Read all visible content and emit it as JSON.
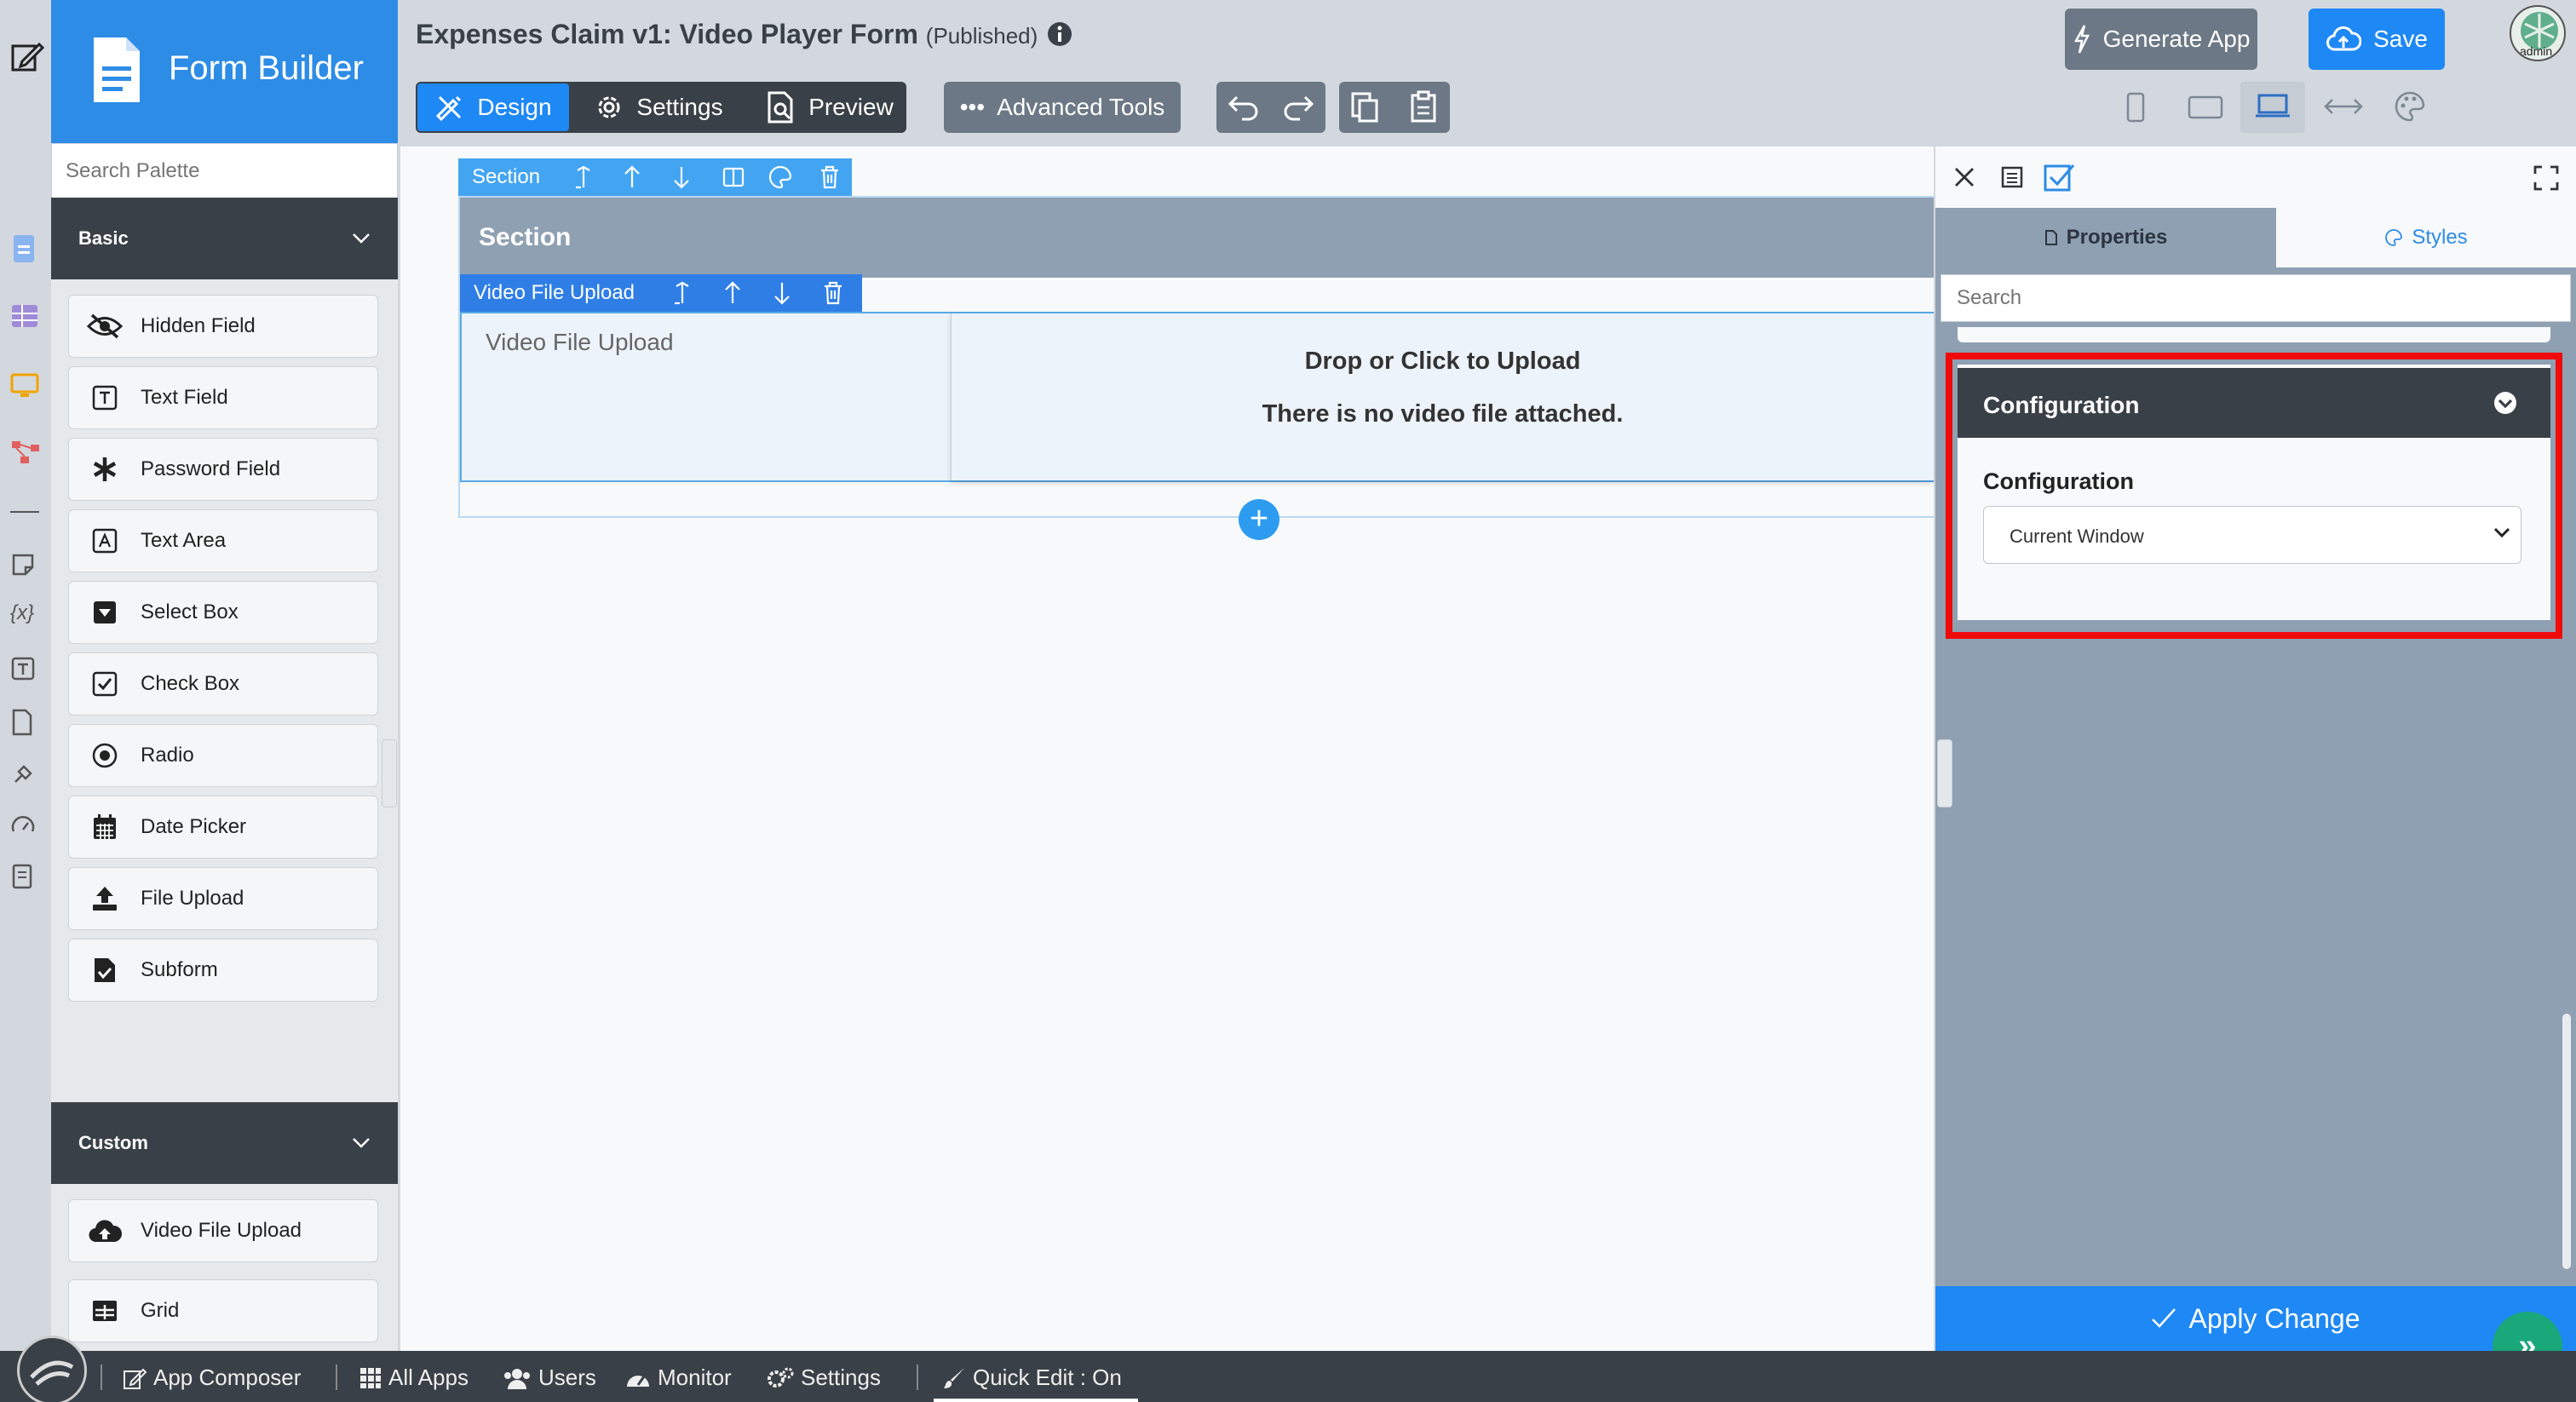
{
  "palette": {
    "brand_title": "Form Builder",
    "search_placeholder": "Search Palette",
    "basic_label": "Basic",
    "custom_label": "Custom",
    "basic_items": [
      "Hidden Field",
      "Text Field",
      "Password Field",
      "Text Area",
      "Select Box",
      "Check Box",
      "Radio",
      "Date Picker",
      "File Upload",
      "Subform"
    ],
    "custom_items": [
      "Video File Upload",
      "Grid"
    ]
  },
  "header": {
    "title": "Expenses Claim v1: Video Player Form",
    "status": "(Published)",
    "tabs": {
      "design": "Design",
      "settings": "Settings",
      "preview": "Preview"
    },
    "advanced_tools": "Advanced Tools",
    "generate_app": "Generate App",
    "save": "Save",
    "avatar_label": "admin"
  },
  "canvas": {
    "section_toolbar_label": "Section",
    "section_title": "Section",
    "field_toolbar_label": "Video File Upload",
    "field_label": "Video File Upload",
    "drop_title": "Drop or Click to Upload",
    "drop_subtitle": "There is no video file attached."
  },
  "properties": {
    "tab_properties": "Properties",
    "tab_styles": "Styles",
    "search_placeholder": "Search",
    "group_title": "Configuration",
    "field_label": "Configuration",
    "select_value": "Current Window",
    "apply_button": "Apply Change"
  },
  "bottom_bar": {
    "app_composer": "App Composer",
    "all_apps": "All Apps",
    "users": "Users",
    "monitor": "Monitor",
    "settings": "Settings",
    "quick_edit": "Quick Edit : On"
  },
  "colors": {
    "accent": "#1e88f5",
    "dark": "#3a4047",
    "highlight": "#f00a0a",
    "success": "#1aa77a"
  }
}
